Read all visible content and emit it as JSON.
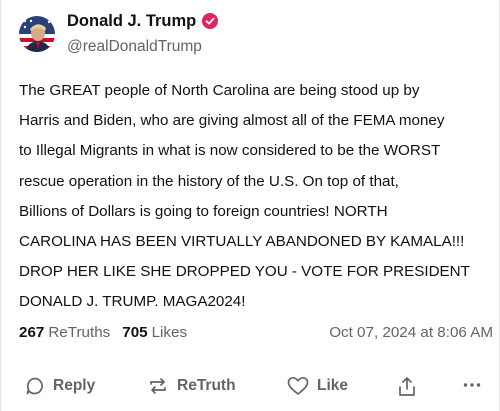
{
  "author": {
    "display_name": "Donald J. Trump",
    "handle": "@realDonaldTrump",
    "avatar_icon": "avatar-flag-portrait-icon",
    "verified_icon": "verified-badge-icon",
    "verified_color": "#e0245e"
  },
  "post": {
    "lines": [
      "The GREAT people of North Carolina are being stood up by",
      "Harris and Biden, who are giving almost all of the FEMA money",
      "to Illegal Migrants in what is now considered to be the WORST",
      "rescue operation in the history of the U.S. On top of that,",
      "Billions of Dollars is going to foreign countries! NORTH",
      "CAROLINA HAS BEEN VIRTUALLY ABANDONED BY KAMALA!!!",
      "DROP HER LIKE SHE DROPPED YOU - VOTE FOR PRESIDENT",
      "DONALD J. TRUMP. MAGA2024!"
    ]
  },
  "stats": {
    "retruths_count": "267",
    "retruths_label": "ReTruths",
    "likes_count": "705",
    "likes_label": "Likes",
    "timestamp": "Oct 07, 2024 at 8:06 AM"
  },
  "actions": {
    "reply_label": "Reply",
    "retruth_label": "ReTruth",
    "like_label": "Like",
    "icons": [
      "reply-icon",
      "retruth-icon",
      "like-icon",
      "share-icon",
      "more-icon"
    ]
  }
}
